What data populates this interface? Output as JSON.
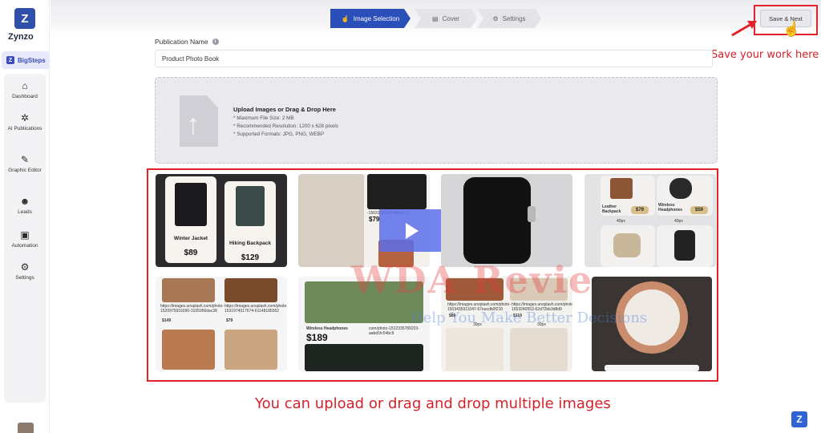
{
  "app": {
    "name": "Zynzo",
    "logo_glyph": "Z",
    "team": "BigSteps"
  },
  "sidebar": {
    "items": [
      {
        "label": "Dashboard",
        "icon": "home-icon"
      },
      {
        "label": "AI Publications",
        "icon": "ai-icon"
      },
      {
        "label": "Graphic Editor",
        "icon": "edit-icon"
      },
      {
        "label": "Leads",
        "icon": "users-icon"
      },
      {
        "label": "Automation",
        "icon": "automation-icon"
      },
      {
        "label": "Settings",
        "icon": "gear-icon"
      }
    ]
  },
  "steps": [
    {
      "label": "Image Selection",
      "active": true
    },
    {
      "label": "Cover",
      "active": false
    },
    {
      "label": "Settings",
      "active": false
    }
  ],
  "toolbar": {
    "save_label": "Save & Next"
  },
  "annotations": {
    "save_note": "Save your work here",
    "upload_note": "You can upload or drag and drop multiple images",
    "accent": "#e3222a"
  },
  "form": {
    "publication_label": "Publication Name",
    "publication_value": "Product Photo Book"
  },
  "dropzone": {
    "title": "Upload Images or Drag & Drop Here",
    "lines": [
      "* Maximum File Size: 2 MB",
      "* Recommended Resolution: 1200 x 628 pixels",
      "* Supported Formats: JPG, PNG, WEBP"
    ]
  },
  "gallery": {
    "winter_name": "Winter Jacket",
    "winter_price": "$89",
    "backpack_name": "Hiking Backpack",
    "backpack_price": "$129",
    "fashion_url": "-1503135991-4f45cb72...",
    "fashion_price": "$79",
    "leather_name": "Leather Backpack",
    "leather_price": "$79",
    "wireless_name": "Wireless Headphones",
    "wireless_price": "$59",
    "size_a": "40px",
    "size_b": "40px",
    "url_a": "https://images.unsplash.com/photo-1520975916090-3105956dac38",
    "price_a": "$149",
    "url_b": "https://images.unsplash.com/photo-1531974017674-61148185552",
    "price_b": "$79",
    "headphones_name": "Wireless Headphones",
    "headphones_url": "com/photo-1522335789203-aabd1fc54bc9",
    "headphones_price": "$189",
    "url_c": "https://images.unsplash.com/photo-1503435911047-67eacdb0f210",
    "price_c": "$69",
    "url_d": "https://images.unsplash.com/photo-1553240553-62d72bb3d8d9",
    "price_d": "$119",
    "size_c": "30px",
    "size_d": "30px"
  },
  "watermark": {
    "main": "WDA Revie",
    "sub": "Help You Make Better Decisions"
  }
}
